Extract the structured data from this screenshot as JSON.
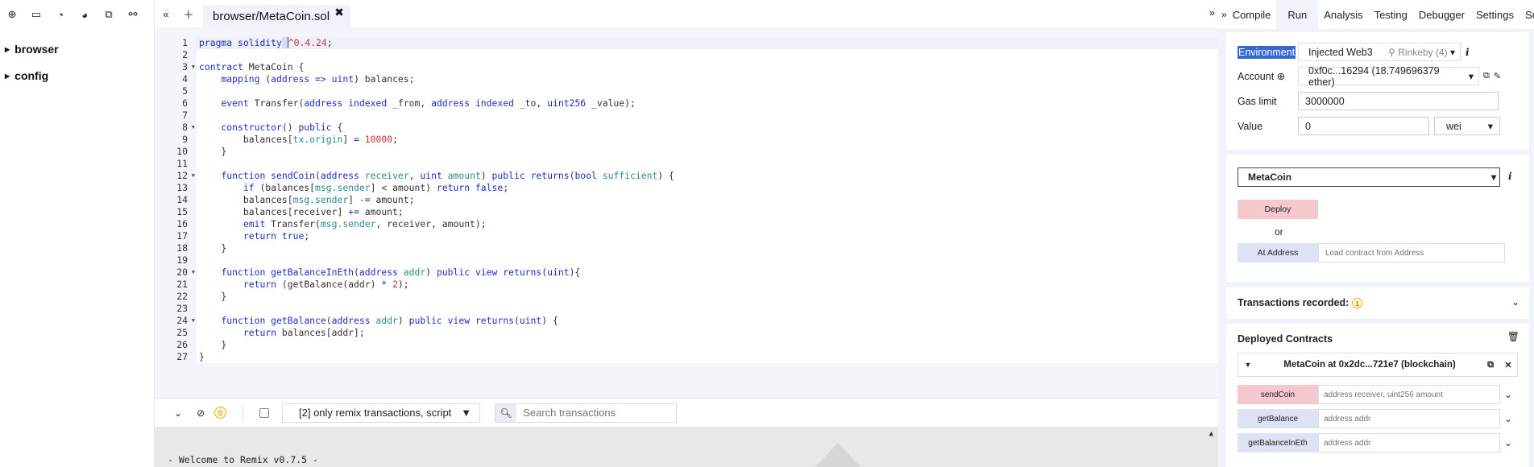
{
  "file_panel": {
    "toolbar_icons": [
      "plus-icon",
      "folder-open-icon",
      "github-icon",
      "github-publish-icon",
      "copy-icon",
      "link-icon"
    ],
    "tree": [
      {
        "label": "browser"
      },
      {
        "label": "config"
      }
    ]
  },
  "editor": {
    "tab_label": "browser/MetaCoin.sol",
    "close_glyph": "✖",
    "line_numbers": [
      "1",
      "2",
      "3",
      "4",
      "5",
      "6",
      "7",
      "8",
      "9",
      "10",
      "11",
      "12",
      "13",
      "14",
      "15",
      "16",
      "17",
      "18",
      "19",
      "20",
      "21",
      "22",
      "23",
      "24",
      "25",
      "26",
      "27"
    ]
  },
  "terminal": {
    "pending_count": "0",
    "filter_label": "[2] only remix transactions, script",
    "search_placeholder": "Search transactions",
    "welcome": "- Welcome to Remix v0.7.5 -"
  },
  "right_panel": {
    "tabs": [
      {
        "label": "Compile"
      },
      {
        "label": "Run"
      },
      {
        "label": "Analysis"
      },
      {
        "label": "Testing"
      },
      {
        "label": "Debugger"
      },
      {
        "label": "Settings"
      },
      {
        "label": "Sup"
      }
    ],
    "active_tab": "Run",
    "environment": {
      "label": "Environment",
      "value": "Injected Web3",
      "network": "Rinkeby (4)"
    },
    "account": {
      "label": "Account",
      "value": "0xf0c...16294 (18.749696379 ether)"
    },
    "gas_limit": {
      "label": "Gas limit",
      "value": "3000000"
    },
    "value_field": {
      "label": "Value",
      "value": "0",
      "unit": "wei"
    },
    "contract_select": "MetaCoin",
    "deploy_label": "Deploy",
    "or_label": "or",
    "at_address_label": "At Address",
    "at_address_placeholder": "Load contract from Address",
    "transactions_recorded": {
      "label": "Transactions recorded:",
      "count": "1"
    },
    "deployed": {
      "title": "Deployed Contracts",
      "instance_label": "MetaCoin at 0x2dc...721e7 (blockchain)",
      "functions": [
        {
          "name": "sendCoin",
          "placeholder": "address receiver, uint256 amount",
          "kind": "tx"
        },
        {
          "name": "getBalance",
          "placeholder": "address addr",
          "kind": "call"
        },
        {
          "name": "getBalanceInEth",
          "placeholder": "address addr",
          "kind": "call"
        }
      ]
    }
  },
  "colors": {
    "panel_bg": "#f0f3f9",
    "transact_button": "#f4c8cd",
    "call_button": "#dde3f5",
    "keyword": "#1c2fc4",
    "number": "#d32b2b"
  }
}
